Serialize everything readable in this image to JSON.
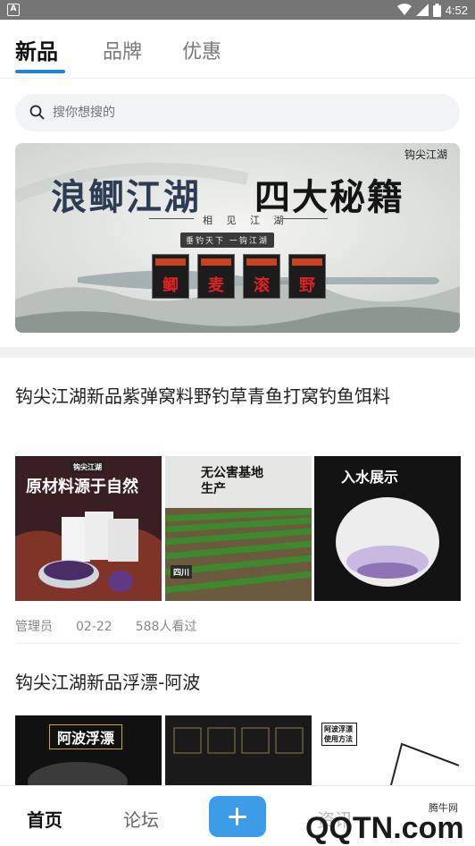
{
  "statusbar": {
    "time": "4:52",
    "app_icon": "A"
  },
  "tabs": [
    {
      "label": "新品",
      "active": true
    },
    {
      "label": "品牌",
      "active": false
    },
    {
      "label": "优惠",
      "active": false
    }
  ],
  "search": {
    "placeholder": "搜你想搜的"
  },
  "banner": {
    "brand": "钩尖江湖",
    "title_left": "浪鲫江湖",
    "title_right": "四大秘籍",
    "subtitle": "相 见 江 湖",
    "tag": "垂钓天下 一钩江湖",
    "products": [
      "鲫",
      "麦",
      "滚",
      "野"
    ]
  },
  "posts": [
    {
      "title": "钩尖江湖新品紫弹窝料野钓草青鱼打窝钓鱼饵料",
      "images": [
        {
          "caption": "原材料源于自然",
          "brand": "钩尖江湖"
        },
        {
          "caption": "无公害基地生产",
          "tag": "四川"
        },
        {
          "caption": "入水展示"
        }
      ],
      "author": "管理员",
      "date": "02-22",
      "views": "588人看过"
    },
    {
      "title": "钩尖江湖新品浮漂-阿波",
      "images": [
        {
          "caption": "阿波浮漂"
        },
        {
          "caption": ""
        },
        {
          "caption": "阿波浮漂使用方法"
        }
      ]
    }
  ],
  "bottomnav": {
    "items": [
      {
        "label": "首页",
        "active": true
      },
      {
        "label": "论坛",
        "active": false
      },
      {
        "label": "资讯",
        "active": false
      }
    ]
  },
  "watermark": {
    "text": "QQTN.com",
    "label": "腾牛网"
  },
  "colors": {
    "accent": "#1f86d8",
    "plus_button": "#3d9ce8",
    "statusbar": "#757575"
  }
}
